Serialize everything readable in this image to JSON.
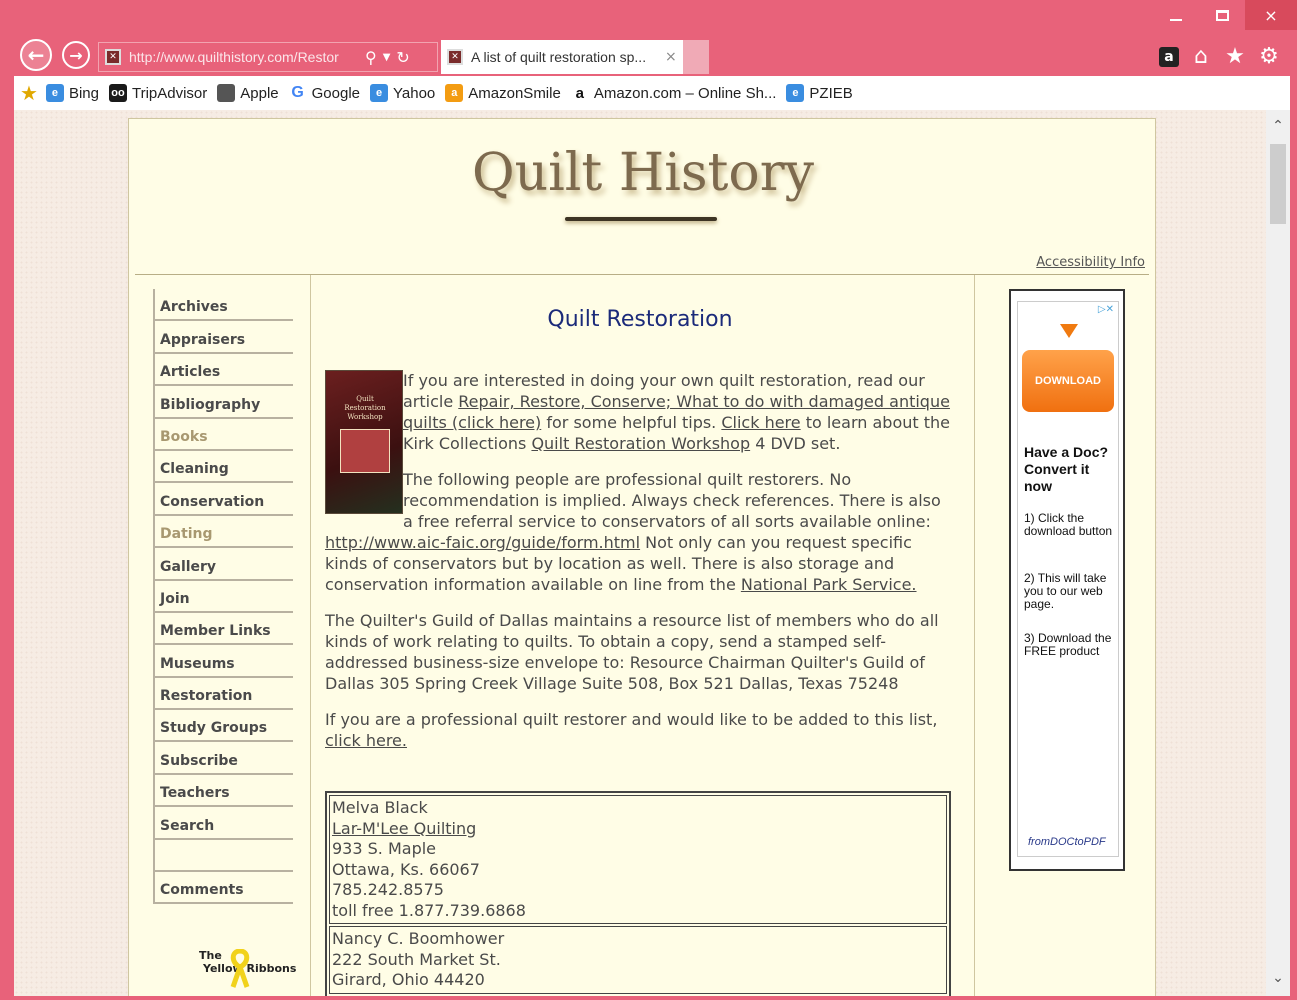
{
  "browser": {
    "url": "http://www.quilthistory.com/Restor",
    "tab_title": "A list of quilt restoration sp...",
    "tab_close": "×",
    "win_close": "×",
    "favorites": [
      {
        "label": "Bing",
        "icon": "ie-icon"
      },
      {
        "label": "TripAdvisor",
        "icon": "tripadvisor-icon"
      },
      {
        "label": "Apple",
        "icon": "apple-icon"
      },
      {
        "label": "Google",
        "icon": "google-icon"
      },
      {
        "label": "Yahoo",
        "icon": "ie-icon"
      },
      {
        "label": "AmazonSmile",
        "icon": "amazon-icon"
      },
      {
        "label": "Amazon.com – Online Sh...",
        "icon": "amazon-icon"
      },
      {
        "label": "PZIEB",
        "icon": "ie-icon"
      }
    ]
  },
  "site": {
    "title": "Quilt History",
    "accessibility": "Accessibility Info",
    "nav": [
      "Archives",
      "Appraisers",
      "Articles",
      "Bibliography",
      "Books",
      "Cleaning",
      "Conservation",
      "Dating",
      "Gallery",
      "Join",
      "Member Links",
      "Museums",
      "Restoration",
      "Study Groups",
      "Subscribe",
      "Teachers",
      "Search",
      "",
      "Comments"
    ],
    "ribbon_text": "The",
    "ribbon_text2": "Yellow Ribbons"
  },
  "content": {
    "heading": "Quilt Restoration",
    "book_label": "Quilt Restoration Workshop",
    "p1_a": "If you are interested in doing your own quilt restoration, read our article ",
    "p1_link1": "Repair, Restore, Conserve; What to do with damaged antique quilts (click here)",
    "p1_b": " for some helpful tips. ",
    "p1_link2": "Click here",
    "p1_c": " to learn about the Kirk Collections ",
    "p1_link3": "Quilt Restoration Workshop",
    "p1_d": " 4 DVD set.",
    "p2_a": "The following people are professional quilt restorers.  No recommendation is implied.  Always check references.   There is also a free referral service to conservators of all sorts available online: ",
    "p2_link1": "http://www.aic-faic.org/guide/form.html",
    "p2_b": " Not only can you request specific kinds of conservators but by location as well. There is also storage and conservation information available on line from the ",
    "p2_link2": "National Park Service.",
    "p3": "The Quilter's Guild of Dallas maintains a resource list of members who do all kinds of work relating to quilts. To obtain a copy, send a stamped self-addressed business-size envelope to:  Resource Chairman Quilter's Guild of Dallas 305 Spring Creek Village Suite 508, Box 521 Dallas, Texas 75248",
    "p4_a": "If you are a professional quilt restorer and would like to be added to this list, ",
    "p4_link": "click here. ",
    "entries": [
      {
        "name": "Melva Black",
        "business": "Lar-M'Lee Quilting",
        "street": "933 S. Maple",
        "city": "Ottawa, Ks. 66067",
        "phone": "785.242.8575",
        "tollfree": "toll free 1.877.739.6868"
      },
      {
        "name": "Nancy C. Boomhower",
        "street": "222 South Market St.",
        "city": "Girard, Ohio 44420"
      }
    ]
  },
  "ad": {
    "badge": "▷✕",
    "button": "DOWNLOAD",
    "headline_1": "Have a Doc?",
    "headline_2": "Convert it",
    "headline_3": "now",
    "step1": "1) Click the download button",
    "step2": "2) This will take you to our web page.",
    "step3": "3) Download the FREE product",
    "footer": "fromDOCtoPDF"
  }
}
